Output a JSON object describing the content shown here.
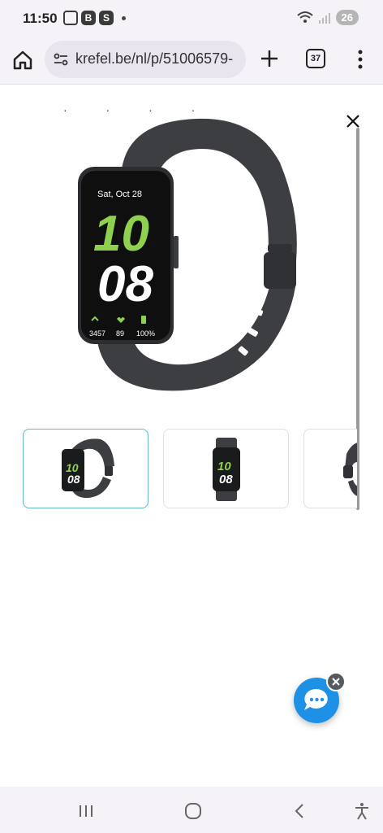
{
  "status_bar": {
    "time": "11:50",
    "icons": [
      "screenshot-icon",
      "b-icon",
      "s-icon"
    ],
    "battery_level": "26"
  },
  "browser": {
    "url": "krefel.be/nl/p/51006579-",
    "tab_count": "37"
  },
  "product": {
    "watch_date": "Sat, Oct 28",
    "watch_hour": "10",
    "watch_minute": "08",
    "watch_steps": "3457",
    "watch_heart": "89",
    "watch_battery": "100%",
    "colors": {
      "band": "#3c3e42",
      "accent": "#8fd14f"
    }
  },
  "thumbnails": [
    {
      "label": "thumb-1",
      "active": true
    },
    {
      "label": "thumb-2",
      "active": false
    },
    {
      "label": "thumb-3",
      "active": false
    }
  ],
  "chat": {
    "accent": "#1e90e6"
  }
}
